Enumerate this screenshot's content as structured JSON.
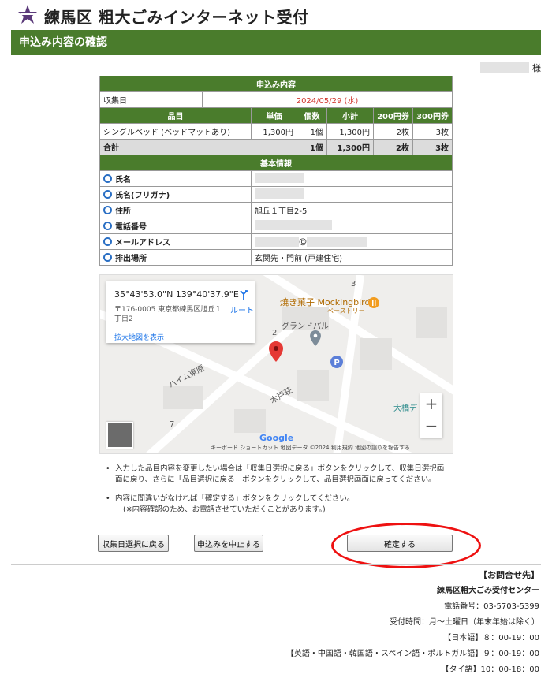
{
  "site": {
    "title": "練馬区 粗大ごみインターネット受付"
  },
  "page": {
    "heading": "申込み内容の確認"
  },
  "user": {
    "suffix": "様"
  },
  "application": {
    "section_title": "申込み内容",
    "collection_date_label": "収集日",
    "collection_date_value": "2024/05/29 (水)",
    "columns": [
      "品目",
      "単価",
      "個数",
      "小計",
      "200円券",
      "300円券"
    ],
    "items": [
      {
        "name": "シングルベッド (ベッドマットあり)",
        "unit_price": "1,300円",
        "qty": "1個",
        "subtotal": "1,300円",
        "ticket200": "2枚",
        "ticket300": "3枚"
      }
    ],
    "total": {
      "label": "合計",
      "qty": "1個",
      "subtotal": "1,300円",
      "ticket200": "2枚",
      "ticket300": "3枚"
    }
  },
  "basic_info": {
    "section_title": "基本情報",
    "rows": [
      {
        "label": "氏名",
        "value": ""
      },
      {
        "label": "氏名(フリガナ)",
        "value": ""
      },
      {
        "label": "住所",
        "value": "旭丘１丁目2-5"
      },
      {
        "label": "電話番号",
        "value": ""
      },
      {
        "label": "メールアドレス",
        "value": "@"
      },
      {
        "label": "排出場所",
        "value": "玄関先・門前 (戸建住宅)"
      }
    ]
  },
  "map": {
    "coords": "35°43'53.0\"N 139°40'37.9\"E",
    "address": "〒176-0005 東京都練馬区旭丘１丁目2",
    "route_label": "ルート",
    "enlarge_link": "拡大地図を表示",
    "labels": {
      "shop": "焼き菓子 Mockingbird",
      "shop_sub": "ベーストリー",
      "building": "グランドパル",
      "haim": "ハイム東原",
      "kido": "木戸荘",
      "ohashi": "大橋デ",
      "num3": "3",
      "num2": "2",
      "num7": "7"
    },
    "google": "Google",
    "footer": "キーボード ショートカット   地図データ ©2024   利用規約   地図の誤りを報告する",
    "zoom_in": "+",
    "zoom_out": "−"
  },
  "notes": [
    "入力した品目内容を変更したい場合は「収集日選択に戻る」ボタンをクリックして、収集日選択画面に戻り、さらに「品目選択に戻る」ボタンをクリックして、品目選択画面に戻ってください。",
    "内容に間違いがなければ「確定する」ボタンをクリックしてください。",
    "(※内容確認のため、お電話させていただくことがあります。)"
  ],
  "buttons": {
    "back_to_date": "収集日選択に戻る",
    "cancel": "申込みを中止する",
    "confirm": "確定する"
  },
  "contact": {
    "heading": "【お問合せ先】",
    "center": "練馬区粗大ごみ受付センター",
    "phone": "電話番号：03-5703-5399",
    "hours": "受付時間：月～土曜日（年末年始は除く）",
    "lang1": "【日本語】８：00-19：00",
    "lang2": "【英語・中国語・韓国語・スペイン語・ポルトガル語】９：00-19：00",
    "lang3": "【タイ語】10：00-18：00"
  },
  "colors": {
    "green": "#4a7c2c",
    "red_date": "#d0342c",
    "highlight_oval": "#ee1111"
  }
}
